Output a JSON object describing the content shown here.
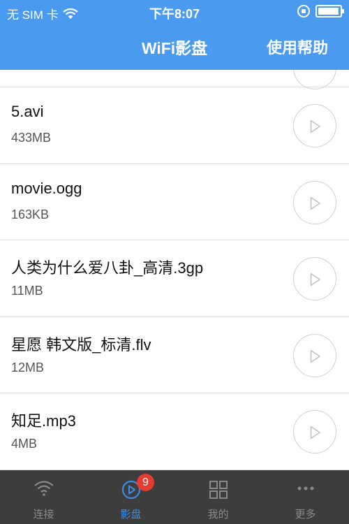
{
  "status_bar": {
    "carrier": "无 SIM 卡",
    "time": "下午8:07",
    "battery_level": 0.95
  },
  "nav": {
    "title": "WiFi影盘",
    "help_label": "使用帮助"
  },
  "files": [
    {
      "name": "5.avi",
      "size": "433MB"
    },
    {
      "name": "movie.ogg",
      "size": "163KB"
    },
    {
      "name": "人类为什么爱八卦_高清.3gp",
      "size": "11MB"
    },
    {
      "name": "星愿 韩文版_标清.flv",
      "size": "12MB"
    },
    {
      "name": "知足.mp3",
      "size": "4MB"
    }
  ],
  "tabbar": {
    "tabs": [
      {
        "label": "连接",
        "icon": "wifi-icon"
      },
      {
        "label": "影盘",
        "icon": "play-icon",
        "active": true
      },
      {
        "label": "我的",
        "icon": "grid-icon"
      },
      {
        "label": "更多",
        "icon": "more-icon"
      }
    ],
    "badge": "9"
  },
  "colors": {
    "header": "#4a9bf0",
    "tabbar": "#3d3d3d",
    "active_tab": "#3a8ee6",
    "badge": "#e63b30"
  }
}
